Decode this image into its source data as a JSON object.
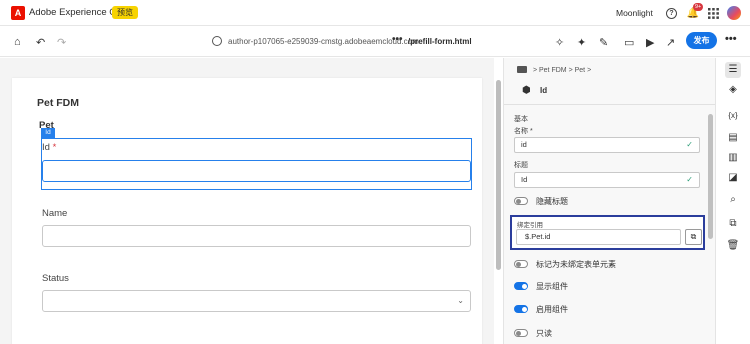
{
  "topbar": {
    "logo_letter": "A",
    "app_title": "Adobe Experience Cloud",
    "beta_badge": "预览",
    "org_name": "Moonlight",
    "notification_count": "9+",
    "help_glyph": "?",
    "bell_glyph": "🔔",
    "apps_glyph": "⋮⋮⋮"
  },
  "toolbar": {
    "home_glyph": "⌂",
    "undo_glyph": "↶",
    "redo_glyph": "↷",
    "url_host": "author-p107065-e259039-cmstg.adobeaemcloud.com",
    "url_dots": "•••",
    "url_path": "/prefill-form.html",
    "publish_label": "发布",
    "more_label": "•••",
    "icons": [
      "wand-icon",
      "magic-icon",
      "edit-icon",
      "desktop-icon",
      "play-icon",
      "share-icon"
    ],
    "glyphs": {
      "wand": "✧",
      "magic": "✦",
      "edit": "✎",
      "desktop": "▭",
      "play": "▶",
      "share": "↗"
    }
  },
  "form": {
    "title": "Pet FDM",
    "panel_title": "Pet",
    "selected_badge": "Id",
    "fields": [
      {
        "label": "Id",
        "required": "*"
      },
      {
        "label": "Name"
      },
      {
        "label": "Status",
        "chevron": "⌄"
      }
    ]
  },
  "properties": {
    "breadcrumb": [
      "Pet FDM",
      "Pet"
    ],
    "crumb_sep": ">",
    "component_icon": "⬢",
    "component_name": "Id",
    "section": "基本",
    "name_label": "名称",
    "name_required": "*",
    "name_value": "id",
    "title_label": "标题",
    "title_value": "Id",
    "check_glyph": "✓",
    "hide_title": "隐藏标题",
    "bind_label": "绑定引用",
    "bind_value": "$.Pet.id",
    "bind_button_glyph": "⧉",
    "mark_unbound": "标记为未绑定表单元素",
    "show_component": "显示组件",
    "enable_component": "启用组件",
    "readonly": "只读",
    "toggles": {
      "hide_title": false,
      "mark_unbound": false,
      "show_component": true,
      "enable_component": true,
      "readonly": false
    }
  },
  "rail": {
    "glyphs": [
      "☰",
      "◈",
      "{x}",
      "▤",
      "▥",
      "◪",
      "⌕",
      "⧉",
      "🗑"
    ]
  }
}
